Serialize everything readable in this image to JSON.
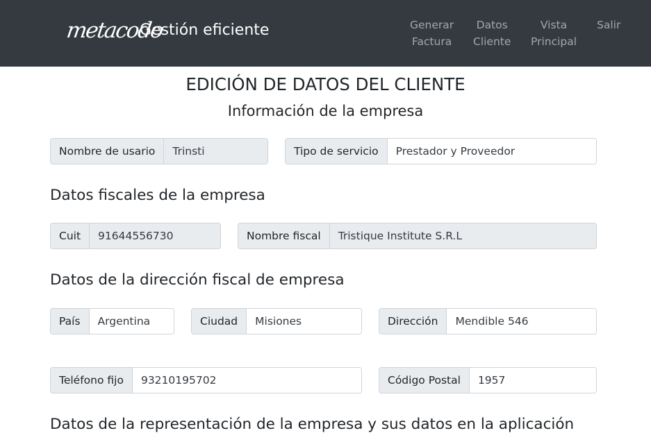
{
  "navbar": {
    "logo_text": "metacodo",
    "brand": "Gestión eficiente",
    "links": [
      {
        "line1": "Generar",
        "line2": "Factura"
      },
      {
        "line1": "Datos",
        "line2": "Cliente"
      },
      {
        "line1": "Vista",
        "line2": "Principal"
      },
      {
        "line1": "Salir",
        "line2": ""
      }
    ]
  },
  "page": {
    "title": "EDICIÓN DE DATOS DEL CLIENTE",
    "subtitle": "Información de la empresa"
  },
  "empresa": {
    "usuario": {
      "label": "Nombre de usario",
      "value": "Trinsti"
    },
    "servicio": {
      "label": "Tipo de servicio",
      "value": "Prestador y Proveedor"
    }
  },
  "fiscales": {
    "heading": "Datos fiscales de la empresa",
    "cuit": {
      "label": "Cuit",
      "value": "91644556730"
    },
    "nombre_fiscal": {
      "label": "Nombre fiscal",
      "value": "Tristique Institute S.R.L"
    }
  },
  "direccion": {
    "heading": "Datos de la dirección fiscal de empresa",
    "pais": {
      "label": "País",
      "value": "Argentina"
    },
    "ciudad": {
      "label": "Ciudad",
      "value": "Misiones"
    },
    "direccion": {
      "label": "Dirección",
      "value": "Mendible 546"
    },
    "telefono": {
      "label": "Teléfono fijo",
      "value": "93210195702"
    },
    "codigo_postal": {
      "label": "Código Postal",
      "value": "1957"
    }
  },
  "representacion": {
    "heading": "Datos de la representación de la empresa y sus datos en la aplicación"
  }
}
